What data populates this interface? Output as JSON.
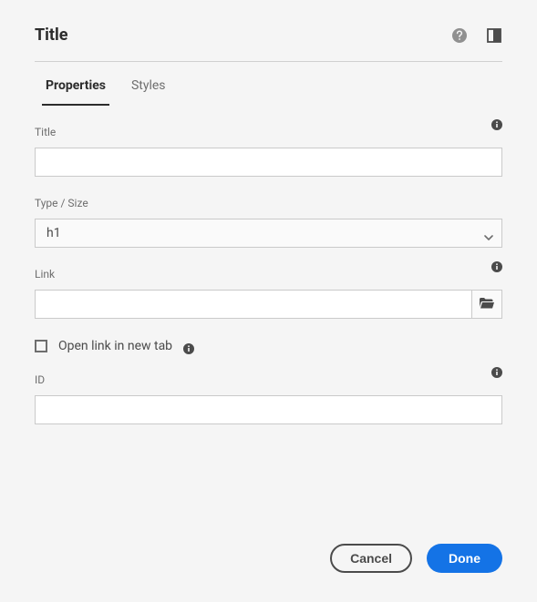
{
  "header": {
    "title": "Title"
  },
  "tabs": {
    "properties": "Properties",
    "styles": "Styles"
  },
  "fields": {
    "title": {
      "label": "Title",
      "value": ""
    },
    "typeSize": {
      "label": "Type / Size",
      "value": "h1"
    },
    "link": {
      "label": "Link",
      "value": ""
    },
    "openNewTab": {
      "label": "Open link in new tab",
      "checked": false
    },
    "id": {
      "label": "ID",
      "value": ""
    }
  },
  "buttons": {
    "cancel": "Cancel",
    "done": "Done"
  }
}
